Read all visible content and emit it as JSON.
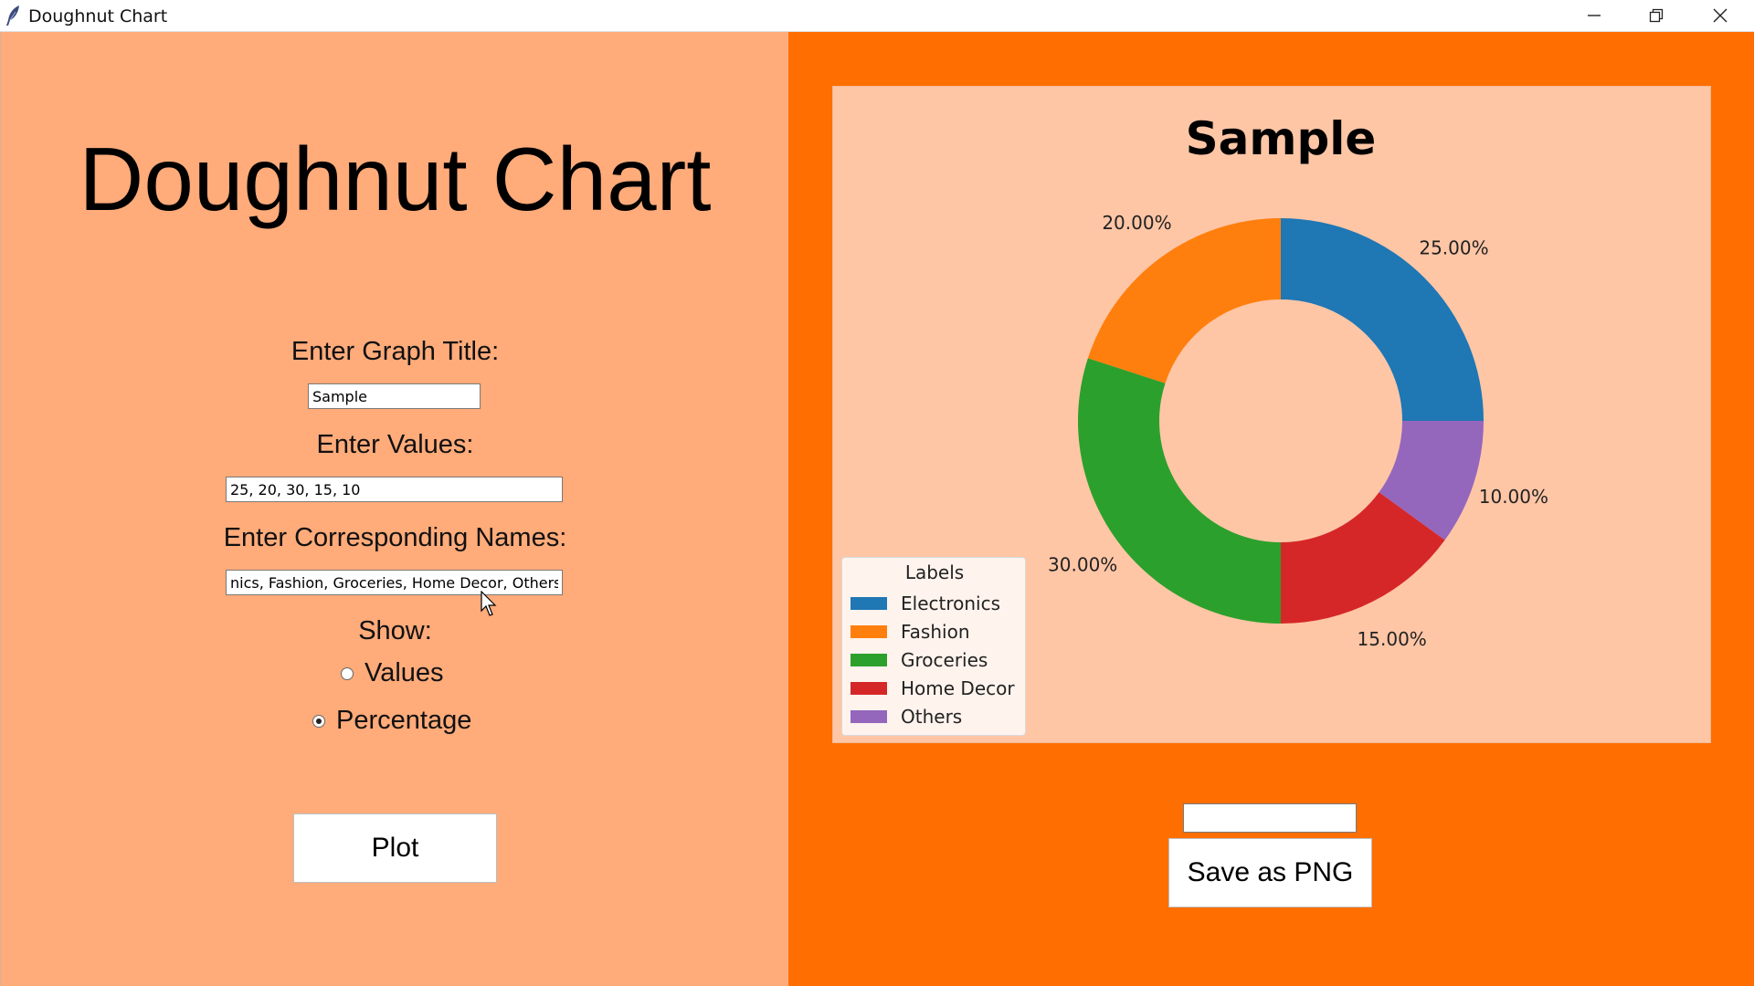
{
  "window": {
    "title": "Doughnut Chart",
    "icon": "feather-icon",
    "controls": [
      "minimize-icon",
      "restore-icon",
      "close-icon"
    ]
  },
  "form": {
    "heading": "Doughnut Chart",
    "title_label": "Enter Graph Title:",
    "title_value": "Sample",
    "values_label": "Enter Values:",
    "values_value": "25, 20, 30, 15, 10",
    "names_label": "Enter Corresponding Names:",
    "names_value": "nics, Fashion, Groceries, Home Decor, Others",
    "show_label": "Show:",
    "option_values": "Values",
    "option_percentage": "Percentage",
    "selected_option": "Percentage",
    "plot_label": "Plot"
  },
  "export": {
    "filename_value": "",
    "save_label": "Save as PNG"
  },
  "colors": {
    "left_panel": "#ffab7a",
    "right_panel": "#ff6e00",
    "chart_background": "#ffc6a6"
  },
  "chart_data": {
    "type": "pie",
    "variant": "doughnut",
    "title": "Sample",
    "categories": [
      "Electronics",
      "Fashion",
      "Groceries",
      "Home Decor",
      "Others"
    ],
    "values": [
      25,
      20,
      30,
      15,
      10
    ],
    "percent_labels": [
      "25.00%",
      "20.00%",
      "30.00%",
      "15.00%",
      "10.00%"
    ],
    "colors": [
      "#1f77b4",
      "#ff7f0e",
      "#2ca02c",
      "#d62728",
      "#9467bd"
    ],
    "start_angle": 0,
    "direction": "counterclockwise",
    "legend_title": "Labels",
    "legend_position": "lower-left"
  }
}
